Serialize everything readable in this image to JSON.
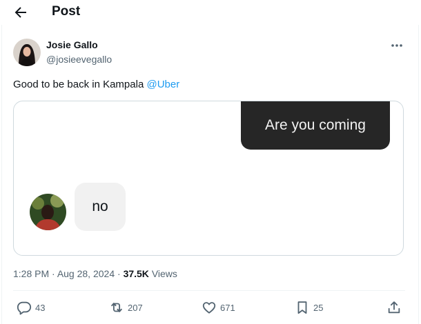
{
  "header": {
    "title": "Post"
  },
  "author": {
    "name": "Josie Gallo",
    "handle": "@josieevegallo"
  },
  "tweet": {
    "text": "Good to be back in Kampala ",
    "mention": "@Uber"
  },
  "media": {
    "message_sent": "Are you coming",
    "message_reply": "no"
  },
  "meta": {
    "time": "1:28 PM",
    "date": "Aug 28, 2024",
    "views_count": "37.5K",
    "views_label": "Views"
  },
  "actions": {
    "replies": "43",
    "reposts": "207",
    "likes": "671",
    "bookmarks": "25"
  },
  "colors": {
    "accent": "#1d9bf0",
    "muted": "#536471",
    "dark_bubble": "#262626"
  }
}
